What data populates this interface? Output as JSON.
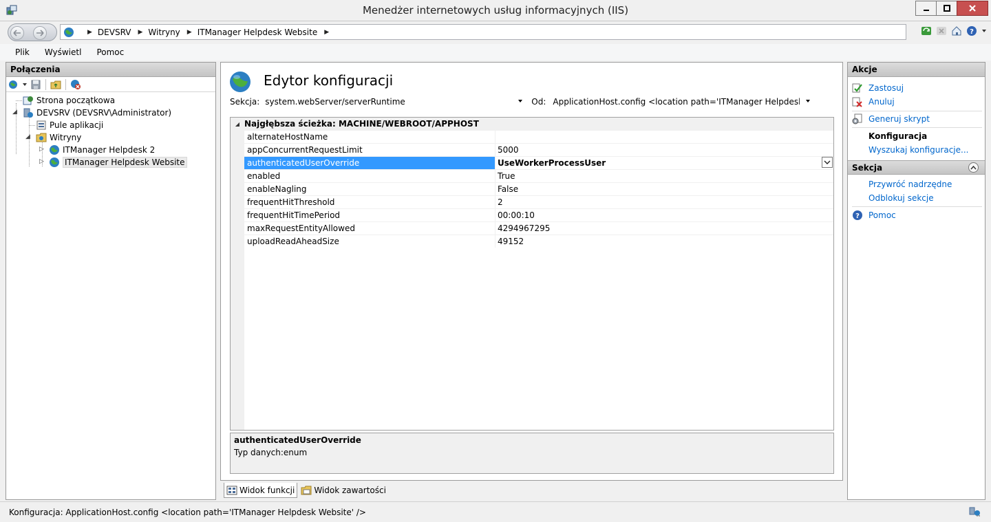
{
  "window": {
    "title": "Menedżer internetowych usług informacyjnych (IIS)"
  },
  "address": {
    "crumbs": [
      "DEVSRV",
      "Witryny",
      "ITManager Helpdesk Website"
    ]
  },
  "menu": {
    "items": [
      "Plik",
      "Wyświetl",
      "Pomoc"
    ]
  },
  "connections": {
    "header": "Połączenia",
    "tree": {
      "start": "Strona początkowa",
      "server": "DEVSRV (DEVSRV\\Administrator)",
      "app_pools": "Pule aplikacji",
      "sites": "Witryny",
      "site1": "ITManager Helpdesk 2",
      "site2": "ITManager Helpdesk Website"
    }
  },
  "editor": {
    "heading": "Edytor konfiguracji",
    "section_label": "Sekcja:",
    "section_value": "system.webServer/serverRuntime",
    "from_label": "Od:",
    "from_value": "ApplicationHost.config <location path='ITManager Helpdesk Websit",
    "category": "Najgłębsza ścieżka: MACHINE/WEBROOT/APPHOST",
    "rows": [
      {
        "name": "alternateHostName",
        "value": ""
      },
      {
        "name": "appConcurrentRequestLimit",
        "value": "5000"
      },
      {
        "name": "authenticatedUserOverride",
        "value": "UseWorkerProcessUser"
      },
      {
        "name": "enabled",
        "value": "True"
      },
      {
        "name": "enableNagling",
        "value": "False"
      },
      {
        "name": "frequentHitThreshold",
        "value": "2"
      },
      {
        "name": "frequentHitTimePeriod",
        "value": "00:00:10"
      },
      {
        "name": "maxRequestEntityAllowed",
        "value": "4294967295"
      },
      {
        "name": "uploadReadAheadSize",
        "value": "49152"
      }
    ],
    "description_title": "authenticatedUserOverride",
    "description_text": "Typ danych:enum"
  },
  "view_tabs": {
    "features": "Widok funkcji",
    "content": "Widok zawartości"
  },
  "actions": {
    "header": "Akcje",
    "apply": "Zastosuj",
    "cancel": "Anuluj",
    "generate_script": "Generuj skrypt",
    "configuration_label": "Konfiguracja",
    "search_config": "Wyszukaj konfiguracje...",
    "section_header": "Sekcja",
    "restore_parent": "Przywróć nadrzędne",
    "unlock_section": "Odblokuj sekcje",
    "help": "Pomoc"
  },
  "status": {
    "text": "Konfiguracja: ApplicationHost.config <location path='ITManager Helpdesk Website' />"
  },
  "colors": {
    "selection": "#3399ff",
    "link": "#0066cc",
    "close_button": "#c75050"
  }
}
